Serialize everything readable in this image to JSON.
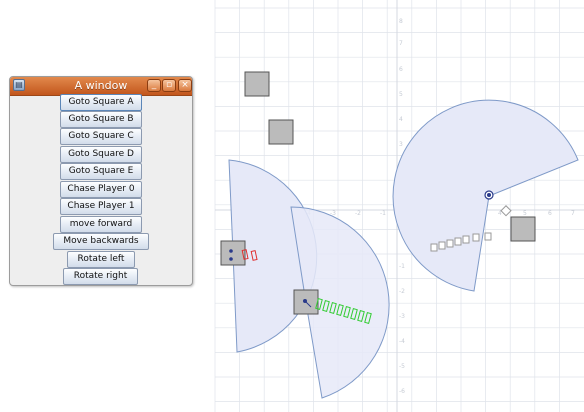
{
  "window": {
    "title": "A window",
    "icon": "java-app-icon",
    "controls": [
      {
        "name": "minimize-button",
        "glyph": "_"
      },
      {
        "name": "maximize-button",
        "glyph": "▫"
      },
      {
        "name": "close-button",
        "glyph": "×"
      }
    ]
  },
  "buttons": [
    {
      "label": "Goto Square A"
    },
    {
      "label": "Goto Square B"
    },
    {
      "label": "Goto Square C"
    },
    {
      "label": "Goto Square D"
    },
    {
      "label": "Goto Square E"
    },
    {
      "label": "Chase Player 0"
    },
    {
      "label": "Chase Player 1"
    },
    {
      "label": "move forward"
    },
    {
      "label": "Move backwards"
    },
    {
      "label": "Rotate left"
    },
    {
      "label": "Rotate right"
    }
  ],
  "colors": {
    "titlebar": "#d06a2e",
    "grid": "#dfe3ea",
    "sector_fill": "#e6e9f8",
    "sector_stroke": "#7f9ac8",
    "square_fill": "#bbbbbb",
    "path_red": "#e03030",
    "path_green": "#33cc33",
    "path_gray": "#999999"
  }
}
